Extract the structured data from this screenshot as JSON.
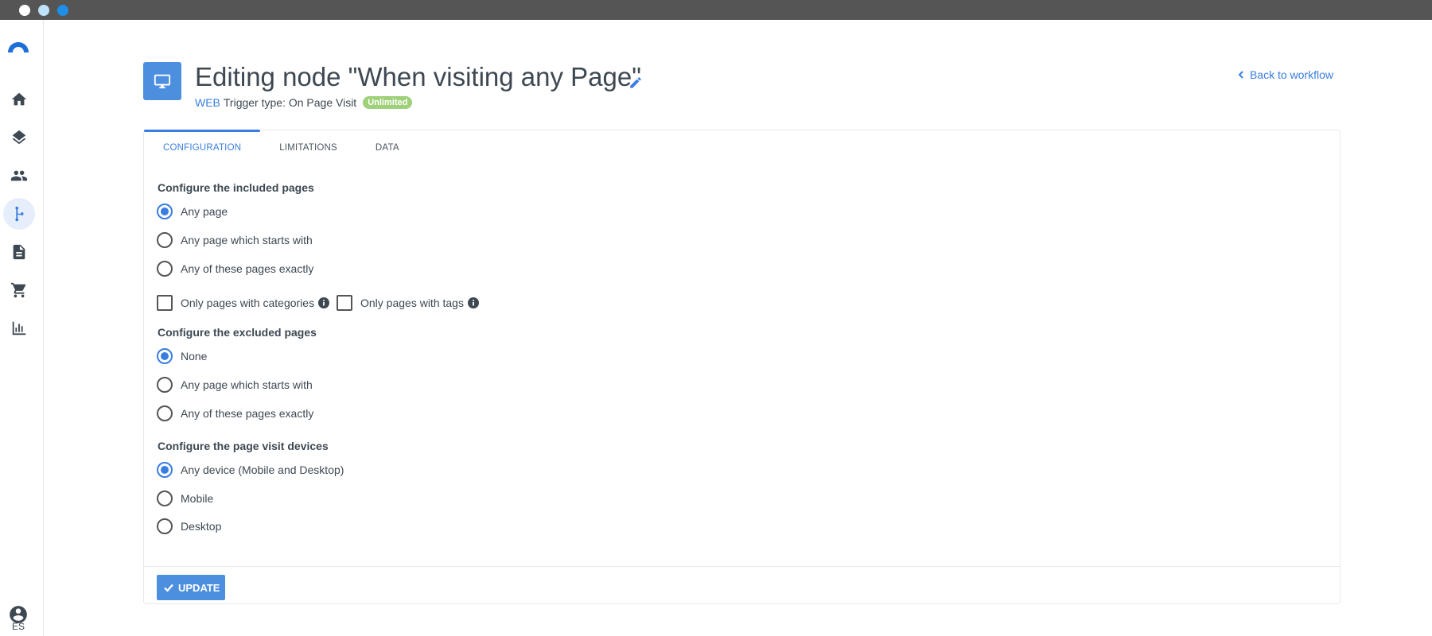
{
  "header": {
    "title": "Editing node \"When visiting any Page\"",
    "channel": "WEB",
    "trigger_type": "Trigger type: On Page Visit",
    "badge": "Unlimited",
    "back_link": "Back to workflow"
  },
  "sidebar": {
    "items": [
      {
        "name": "home-icon"
      },
      {
        "name": "layers-icon"
      },
      {
        "name": "people-icon"
      },
      {
        "name": "workflow-icon",
        "active": true
      },
      {
        "name": "document-icon"
      },
      {
        "name": "cart-icon"
      },
      {
        "name": "bar-chart-icon"
      }
    ],
    "language": "ES"
  },
  "tabs": [
    "CONFIGURATION",
    "LIMITATIONS",
    "DATA"
  ],
  "included": {
    "label": "Configure the included pages",
    "options": [
      "Any page",
      "Any page which starts with",
      "Any of these pages exactly"
    ],
    "selected": 0,
    "checkboxes": [
      "Only pages with categories",
      "Only pages with tags"
    ]
  },
  "excluded": {
    "label": "Configure the excluded pages",
    "options": [
      "None",
      "Any page which starts with",
      "Any of these pages exactly"
    ],
    "selected": 0
  },
  "devices": {
    "label": "Configure the page visit devices",
    "options": [
      "Any device (Mobile and Desktop)",
      "Mobile",
      "Desktop"
    ],
    "selected": 0
  },
  "footer": {
    "update_label": "UPDATE"
  },
  "colors": {
    "accent": "#3a7de0",
    "badge": "#9fd07a",
    "titlebar": "#555555"
  }
}
